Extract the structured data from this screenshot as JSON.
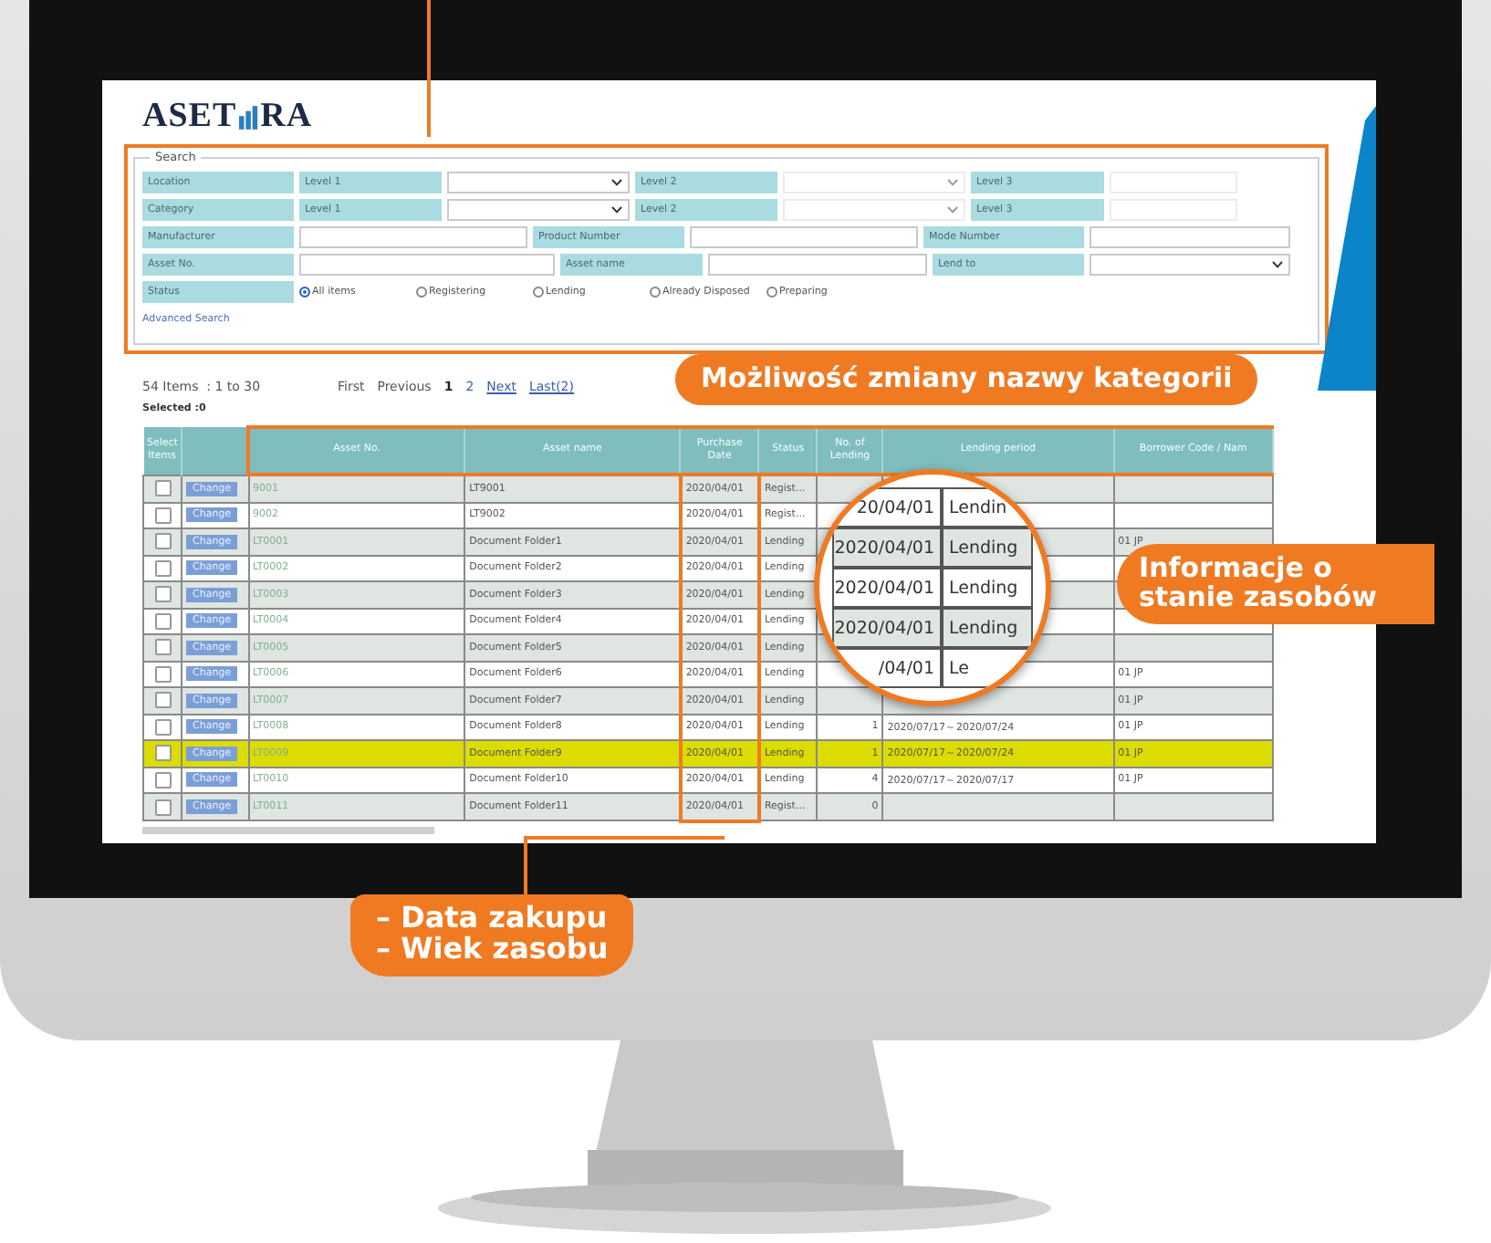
{
  "logo": {
    "left": "ASET",
    "right": "RA"
  },
  "search": {
    "title": "Search",
    "location": {
      "label": "Location",
      "level1": "Level 1",
      "level2": "Level 2",
      "level3": "Level 3"
    },
    "category": {
      "label": "Category",
      "level1": "Level 1",
      "level2": "Level 2",
      "level3": "Level 3"
    },
    "manufacturer": "Manufacturer",
    "product_number": "Product Number",
    "model_number": "Mode Number",
    "asset_no": "Asset No.",
    "asset_name": "Asset name",
    "lend_to": "Lend to",
    "status_label": "Status",
    "status_options": [
      {
        "label": "All items",
        "selected": true
      },
      {
        "label": "Registering",
        "selected": false
      },
      {
        "label": "Lending",
        "selected": false
      },
      {
        "label": "Already Disposed",
        "selected": false
      },
      {
        "label": "Preparing",
        "selected": false
      }
    ],
    "advanced": "Advanced Search"
  },
  "pagination": {
    "summary": "54 Items  : 1 to 30",
    "first": "First",
    "previous": "Previous",
    "pages": [
      {
        "label": "1",
        "selected": true
      },
      {
        "label": "2",
        "selected": false
      }
    ],
    "next": "Next",
    "last": "Last(2)"
  },
  "selected_count": "Selected :0",
  "table": {
    "columns": [
      "Select Items",
      "Asset No.",
      "Asset name",
      "Purchase Date",
      "Status",
      "No. of Lending",
      "Lending period",
      "Borrower Code / Nam"
    ],
    "rows": [
      {
        "checked": false,
        "button": "Change",
        "asset_no": "9001",
        "asset_name": "LT9001",
        "date": "2020/04/01",
        "status": "Regist...",
        "highlighted": false
      },
      {
        "checked": false,
        "button": "Change",
        "asset_no": "9002",
        "asset_name": "LT9002",
        "date": "2020/04/01",
        "status": "Regist...",
        "highlighted": false
      },
      {
        "checked": false,
        "button": "Change",
        "asset_no": "LT0001",
        "asset_name": "Document Folder1",
        "date": "2020/04/01",
        "status": "Lending",
        "borrower": "01 JP",
        "highlighted": false
      },
      {
        "checked": false,
        "button": "Change",
        "asset_no": "LT0002",
        "asset_name": "Document Folder2",
        "date": "2020/04/01",
        "status": "Lending",
        "highlighted": false
      },
      {
        "checked": false,
        "button": "Change",
        "asset_no": "LT0003",
        "asset_name": "Document Folder3",
        "date": "2020/04/01",
        "status": "Lending",
        "highlighted": false
      },
      {
        "checked": false,
        "button": "Change",
        "asset_no": "LT0004",
        "asset_name": "Document Folder4",
        "date": "2020/04/01",
        "status": "Lending",
        "highlighted": false
      },
      {
        "checked": false,
        "button": "Change",
        "asset_no": "LT0005",
        "asset_name": "Document Folder5",
        "date": "2020/04/01",
        "status": "Lending",
        "highlighted": false
      },
      {
        "checked": false,
        "button": "Change",
        "asset_no": "LT0006",
        "asset_name": "Document Folder6",
        "date": "2020/04/01",
        "status": "Lending",
        "borrower": "01 JP",
        "highlighted": false
      },
      {
        "checked": false,
        "button": "Change",
        "asset_no": "LT0007",
        "asset_name": "Document Folder7",
        "date": "2020/04/01",
        "status": "Lending",
        "borrower": "01 JP",
        "highlighted": false
      },
      {
        "checked": false,
        "button": "Change",
        "asset_no": "LT0008",
        "asset_name": "Document Folder8",
        "date": "2020/04/01",
        "status": "Lending",
        "count": "1",
        "period": "2020/07/17～2020/07/24",
        "borrower": "01 JP",
        "highlighted": false
      },
      {
        "checked": false,
        "button": "Change",
        "asset_no": "LT0009",
        "asset_name": "Document Folder9",
        "date": "2020/04/01",
        "status": "Lending",
        "count": "1",
        "period": "2020/07/17～2020/07/24",
        "borrower": "01 JP",
        "highlighted": true
      },
      {
        "checked": false,
        "button": "Change",
        "asset_no": "LT0010",
        "asset_name": "Document Folder10",
        "date": "2020/04/01",
        "status": "Lending",
        "count": "4",
        "period": "2020/07/17～2020/07/17",
        "borrower": "01 JP",
        "highlighted": false
      },
      {
        "checked": false,
        "button": "Change",
        "asset_no": "LT0011",
        "asset_name": "Document Folder11",
        "date": "2020/04/01",
        "status": "Regist...",
        "count": "0",
        "highlighted": false
      }
    ]
  },
  "magnifier": [
    {
      "date": "20/04/01",
      "status": "Lendin"
    },
    {
      "date": "2020/04/01",
      "status": "Lending"
    },
    {
      "date": "2020/04/01",
      "status": "Lending"
    },
    {
      "date": "2020/04/01",
      "status": "Lending"
    },
    {
      "date": "/04/01",
      "status": "Le"
    }
  ],
  "callouts": {
    "category": "Możliwość zmiany nazwy kategorii",
    "status": "Informacje o stanie zasobów",
    "purchase": [
      "– Data zakupu",
      "– Wiek zasobu"
    ]
  }
}
